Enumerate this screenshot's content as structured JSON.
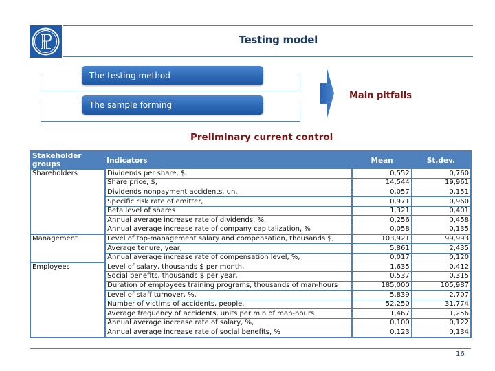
{
  "header": {
    "logo": "hse-logo",
    "title": "Testing model"
  },
  "diagram": {
    "boxes": [
      {
        "label": "The testing method"
      },
      {
        "label": "The sample forming"
      }
    ],
    "arrow_icon": "right-chevron-arrow",
    "result_label": "Main pitfalls"
  },
  "section_title": "Preliminary current control",
  "table": {
    "headers": [
      "Stakeholder groups",
      "Indicators",
      "Mean",
      "St.dev."
    ],
    "rows": [
      {
        "group": "Shareholders",
        "indicator": "Dividends per share, $,",
        "mean": "0,552",
        "stdev": "0,760"
      },
      {
        "group": "",
        "indicator": "Share price, $,",
        "mean": "14,544",
        "stdev": "19,961"
      },
      {
        "group": "",
        "indicator": "Dividends nonpayment accidents, un.",
        "mean": "0,057",
        "stdev": "0,151"
      },
      {
        "group": "",
        "indicator": "Specific risk rate of emitter,",
        "mean": "0,971",
        "stdev": "0,960"
      },
      {
        "group": "",
        "indicator": "Beta level of shares",
        "mean": "1,321",
        "stdev": "0,401"
      },
      {
        "group": "",
        "indicator": "Annual average increase rate of dividends, %,",
        "mean": "0,256",
        "stdev": "0,458"
      },
      {
        "group": "",
        "indicator": "Annual average increase rate of company capitalization, %",
        "mean": "0,058",
        "stdev": "0,135"
      },
      {
        "group": "Management",
        "indicator": "Level of top-management salary and compensation, thousands $,",
        "mean": "103,921",
        "stdev": "99,993"
      },
      {
        "group": "",
        "indicator": "Average tenure, year,",
        "mean": "5,861",
        "stdev": "2,435"
      },
      {
        "group": "",
        "indicator": "Annual average increase rate of compensation level, %,",
        "mean": "0,017",
        "stdev": "0,120"
      },
      {
        "group": "Employees",
        "indicator": "Level of salary, thousands $ per month,",
        "mean": "1,635",
        "stdev": "0,412"
      },
      {
        "group": "",
        "indicator": "Social benefits, thousands $ per year,",
        "mean": "0,537",
        "stdev": "0,315"
      },
      {
        "group": "",
        "indicator": "Duration of employees training programs, thousands of man-hours",
        "mean": "185,000",
        "stdev": "105,987"
      },
      {
        "group": "",
        "indicator": "Level of staff turnover, %,",
        "mean": "5,839",
        "stdev": "2,707"
      },
      {
        "group": "",
        "indicator": "Number of victims of accidents, people,",
        "mean": "52,250",
        "stdev": "31,774"
      },
      {
        "group": "",
        "indicator": "Average frequency of accidents, units per mln of man-hours",
        "mean": "1,467",
        "stdev": "1,256"
      },
      {
        "group": "",
        "indicator": "Annual average increase rate of salary, %,",
        "mean": "0,100",
        "stdev": "0,122"
      },
      {
        "group": "",
        "indicator": "Annual average increase rate of social benefits, %",
        "mean": "0,123",
        "stdev": "0,134"
      }
    ]
  },
  "footer": {
    "page_number": "16"
  },
  "colors": {
    "accent_blue": "#4f81bd",
    "title_navy": "#1f3b5e",
    "highlight_red": "#7a1414"
  }
}
